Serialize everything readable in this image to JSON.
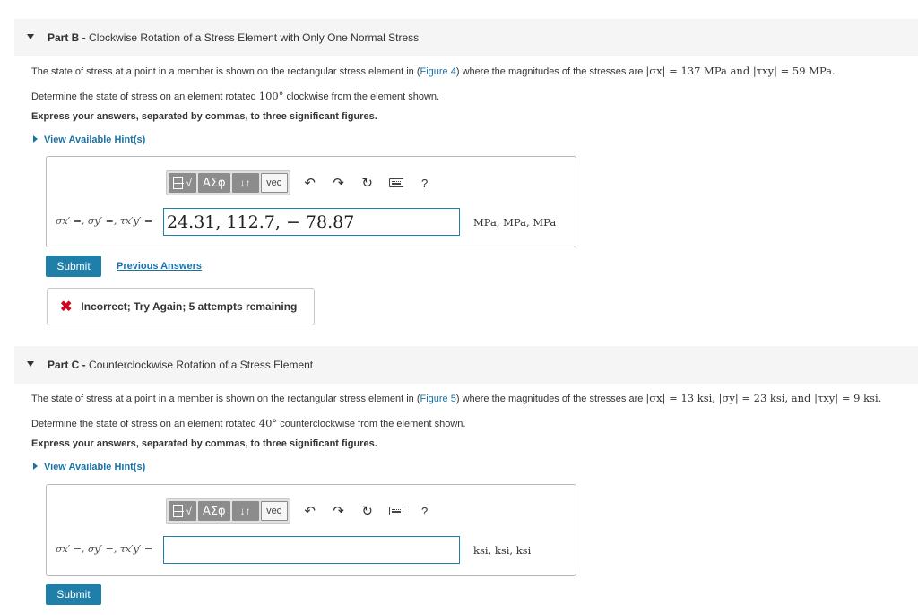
{
  "partB": {
    "label": "Part B -",
    "title": "Clockwise Rotation of a Stress Element with Only One Normal Stress",
    "problem_pre": "The state of stress at a point in a member is shown on the rectangular stress element in (",
    "figure_link": "Figure 4",
    "problem_post": ") where the magnitudes of the stresses are",
    "problem_math": "|σx| = 137 MPa and |τxy| = 59 MPa.",
    "determine": "Determine the state of stress on an element rotated",
    "angle": "100°",
    "determine_post": "clockwise from the element shown.",
    "express": "Express your answers, separated by commas, to three significant figures.",
    "hint": "View Available Hint(s)",
    "input_label": "σx′ =, σy′ =, τx′y′ =",
    "input_value": "24.31, 112.7, − 78.87",
    "units": "MPa, MPa, MPa",
    "submit": "Submit",
    "previous_answers": "Previous Answers",
    "feedback": "Incorrect; Try Again; 5 attempts remaining"
  },
  "partC": {
    "label": "Part C -",
    "title": "Counterclockwise Rotation of a Stress Element",
    "problem_pre": "The state of stress at a point in a member is shown on the rectangular stress element in (",
    "figure_link": "Figure 5",
    "problem_post": ") where the magnitudes of the stresses are",
    "problem_math": "|σx| = 13 ksi, |σy| = 23 ksi, and |τxy| = 9 ksi.",
    "determine": "Determine the state of stress on an element rotated",
    "angle": "40°",
    "determine_post": "counterclockwise from the element shown.",
    "express": "Express your answers, separated by commas, to three significant figures.",
    "hint": "View Available Hint(s)",
    "input_label": "σx′ =, σy′ =, τx′y′ =",
    "input_value": "",
    "units": "ksi, ksi, ksi",
    "submit": "Submit"
  },
  "toolbar": {
    "template_label": "√",
    "greek_label": "ΑΣφ",
    "arrows_label": "↓↑",
    "vec_label": "vec",
    "undo": "↶",
    "redo": "↷",
    "reset": "↻",
    "help": "?"
  }
}
